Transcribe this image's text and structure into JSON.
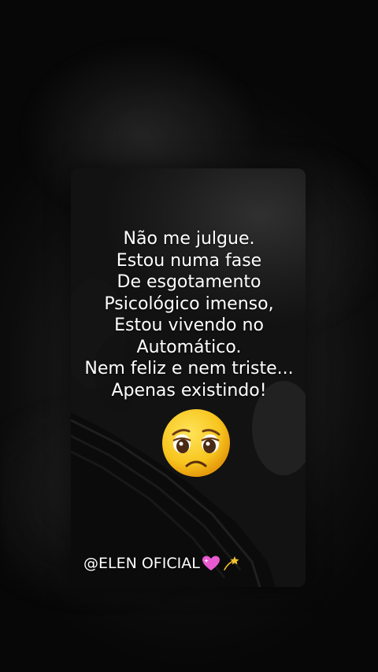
{
  "quote": {
    "lines": [
      "Não me julgue.",
      "Estou numa fase",
      "De esgotamento",
      "Psicológico imenso,",
      "Estou vivendo no",
      "Automático.",
      "Nem feliz e nem triste...",
      "Apenas existindo!"
    ]
  },
  "emoji": "pleading-sad-face",
  "watermark": {
    "text": "@ELEN OFICIAL",
    "icons": [
      "sparkling-heart-icon",
      "dizzy-star-icon"
    ]
  },
  "colors": {
    "text": "#ffffff",
    "emoji_face": "#f7c51e",
    "heart": "#e95ad0",
    "star": "#f2c12e"
  }
}
